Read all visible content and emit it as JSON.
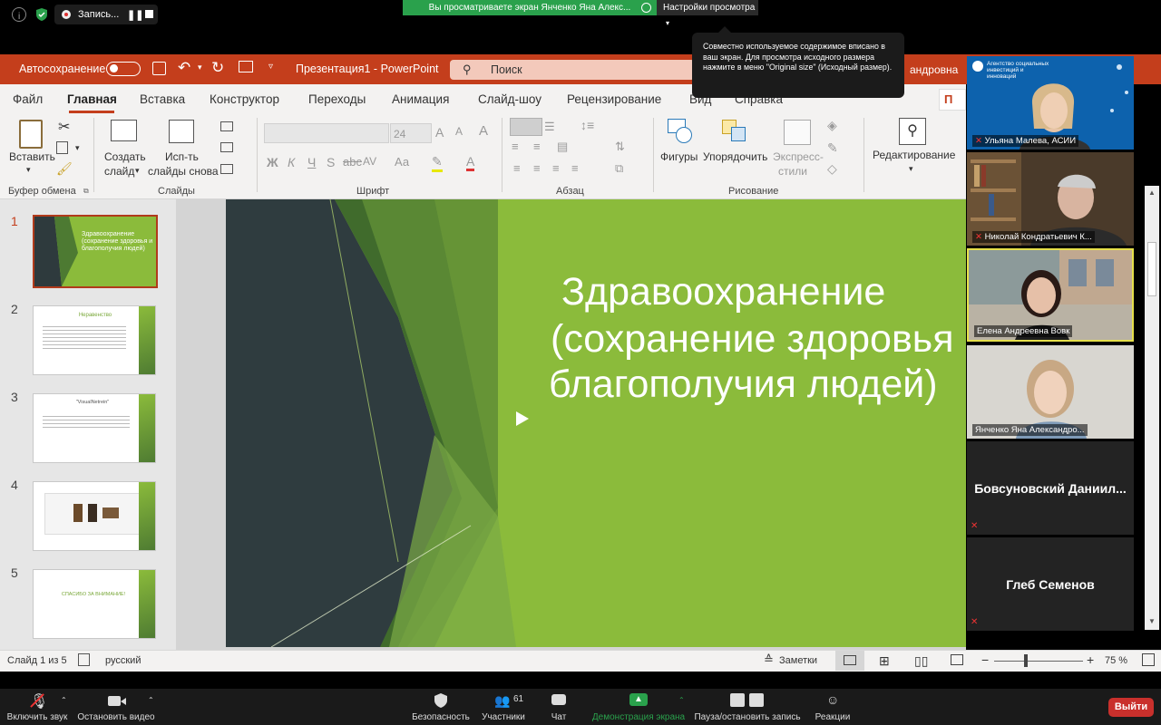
{
  "zoom_top": {
    "recording_label": "Запись...",
    "viewing_banner": "Вы просматриваете экран Янченко Яна Алекс...",
    "view_settings": "Настройки просмотра"
  },
  "tooltip": {
    "text": "Совместно используемое содержимое вписано в ваш экран. Для просмотра исходного размера нажмите в меню \"Original size\" (Исходный размер)."
  },
  "powerpoint": {
    "autosave_label": "Автосохранение",
    "doc_title": "Презентация1 - PowerPoint",
    "search_placeholder": "Поиск",
    "user_fragment": "андровна",
    "tabs": [
      "Файл",
      "Главная",
      "Вставка",
      "Конструктор",
      "Переходы",
      "Анимация",
      "Слайд-шоу",
      "Рецензирование",
      "Вид",
      "Справка"
    ],
    "active_tab": "Главная",
    "ribbon": {
      "paste": "Вставить",
      "clipboard_group": "Буфер обмена",
      "new_slide_1": "Создать",
      "new_slide_2": "слайд",
      "reuse_1": "Исп-ть",
      "reuse_2": "слайды снова",
      "slides_group": "Слайды",
      "font_size": "24",
      "font_group": "Шрифт",
      "paragraph_group": "Абзац",
      "shapes": "Фигуры",
      "arrange": "Упорядочить",
      "quick_styles_1": "Экспресс-",
      "quick_styles_2": "стили",
      "drawing_group": "Рисование",
      "editing": "Редактирование",
      "bold": "Ж",
      "italic": "К",
      "underline": "Ч",
      "strike": "S",
      "aa": "Аа"
    },
    "slides": [
      {
        "num": "1",
        "title": "Здравоохранение (сохранение здоровья и благополучия людей)"
      },
      {
        "num": "2",
        "title": "Неравенство"
      },
      {
        "num": "3",
        "title": "\"VisualNetrein\""
      },
      {
        "num": "4",
        "title": ""
      },
      {
        "num": "5",
        "title": "СПАСИБО ЗА ВНИМАНИЕ!"
      }
    ],
    "main_slide": {
      "line1": "Здравоохранение",
      "line2": "(сохранение здоровья и",
      "line3": "благополучия людей)"
    },
    "status": {
      "slide_of": "Слайд 1 из 5",
      "language": "русский",
      "notes": "Заметки",
      "zoom": "75 %"
    }
  },
  "participants": [
    {
      "name": "Ульяна Малева, АСИИ",
      "org_text": "Агентство социальных инвестиций и инноваций"
    },
    {
      "name": "Николай Кондратьевич К..."
    },
    {
      "name": "Елена Андреевна Вовк"
    },
    {
      "name": "Янченко Яна Александро..."
    },
    {
      "name": "Бовсуновский Даниил..."
    },
    {
      "name": "Глеб Семенов"
    }
  ],
  "zoom_bottom": {
    "mute": "Включить звук",
    "stop_video": "Остановить видео",
    "security": "Безопасность",
    "participants": "Участники",
    "participants_count": "61",
    "chat": "Чат",
    "share": "Демонстрация экрана",
    "pause_record": "Пауза/остановить запись",
    "reactions": "Реакции",
    "leave": "Выйти"
  },
  "colors": {
    "pp_red": "#c43e1c",
    "slide_green": "#8bbb3b",
    "zoom_green": "#2aa14c",
    "leave_red": "#c9302c"
  }
}
